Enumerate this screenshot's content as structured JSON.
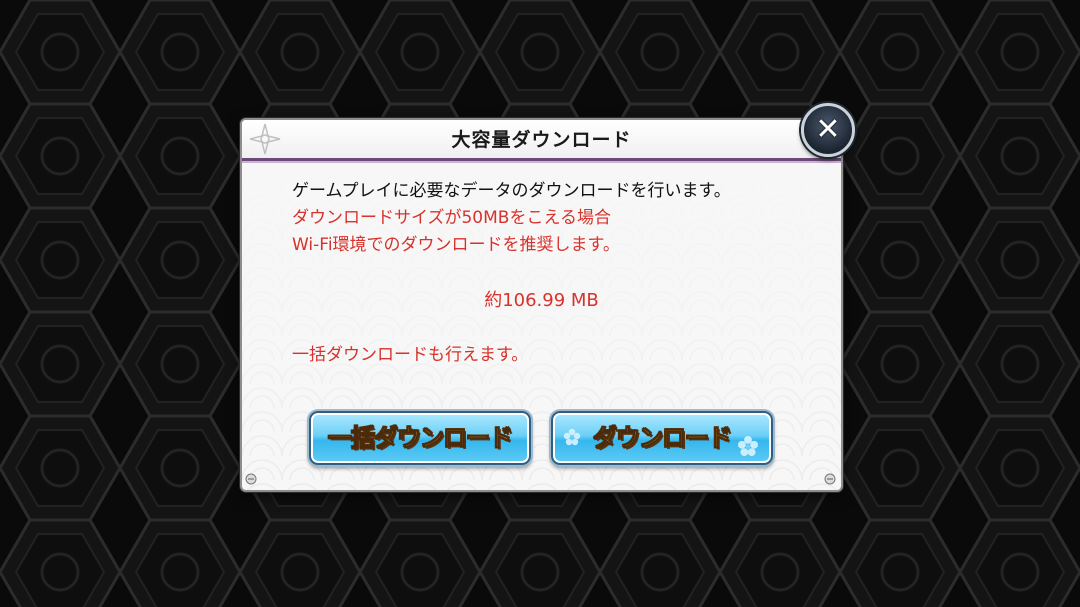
{
  "dialog": {
    "title": "大容量ダウンロード",
    "message_line1": "ゲームプレイに必要なデータのダウンロードを行います。",
    "message_line2": "ダウンロードサイズが50MBをこえる場合",
    "message_line3": "Wi-Fi環境でのダウンロードを推奨します。",
    "download_size": "約106.99 MB",
    "bulk_note": "一括ダウンロードも行えます。",
    "bulk_button_label": "一括ダウンロード",
    "download_button_label": "ダウンロード",
    "close_icon": "close-icon"
  },
  "colors": {
    "background": "#0a0a0a",
    "warning_text": "#d8322c",
    "title_underline": "#6b4a7a",
    "button_fill": "#35b7ee",
    "button_label": "#ffd02a"
  }
}
